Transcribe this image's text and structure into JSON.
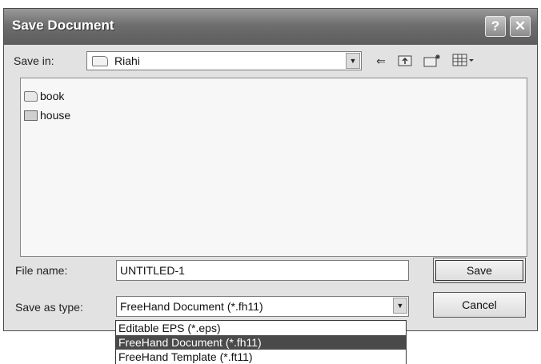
{
  "dialog": {
    "title": "Save Document",
    "help_glyph": "?",
    "close_glyph": "✕"
  },
  "save_in": {
    "label": "Save in:",
    "value": "Riahi",
    "icon": "folder-icon"
  },
  "toolbar": {
    "back_icon": "back-arrow-icon",
    "up_icon": "up-folder-icon",
    "new_folder_icon": "new-folder-icon",
    "view_icon": "view-menu-icon"
  },
  "files": [
    {
      "name": "book",
      "icon": "folder-icon"
    },
    {
      "name": "house",
      "icon": "file-icon"
    }
  ],
  "file_name": {
    "label": "File name:",
    "value": "UNTITLED-1"
  },
  "save_as_type": {
    "label": "Save as type:",
    "value": "FreeHand Document (*.fh11)",
    "options": [
      "Editable EPS (*.eps)",
      "FreeHand Document (*.fh11)",
      "FreeHand Template (*.ft11)"
    ],
    "selected_index": 1
  },
  "buttons": {
    "save": "Save",
    "cancel": "Cancel"
  }
}
